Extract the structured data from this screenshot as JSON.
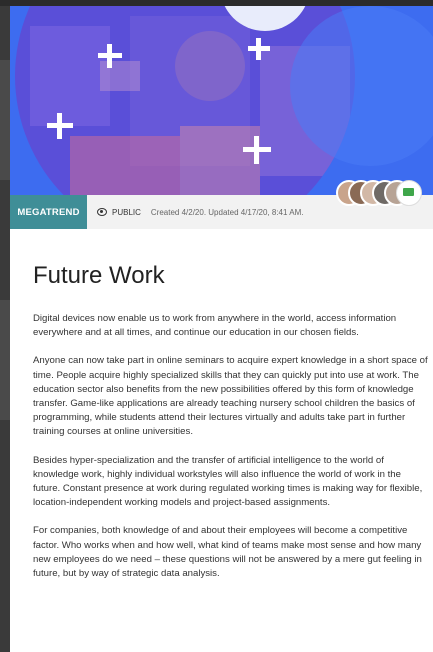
{
  "badge": "MEGATREND",
  "visibility": "PUBLIC",
  "dates": "Created 4/2/20. Updated 4/17/20, 8:41 AM.",
  "title": "Future Work",
  "paragraphs": [
    "Digital devices now enable us to work from anywhere in the world, access information everywhere and at all times, and continue our education in our chosen fields.",
    "Anyone can now take part in online seminars to acquire expert knowledge in a short space of time. People acquire highly specialized skills that they can quickly put into use at work. The education sector also benefits from the new possibilities offered by this form of knowledge transfer. Game-like applications are already teaching nursery school children the basics of programming, while students attend their lectures virtually and adults take part in further training courses at online universities.",
    "Besides hyper-specialization and the transfer of artificial intelligence to the world of knowledge work, highly individual workstyles will also influence the world of work in the future. Constant presence at work during regulated working times is making way for flexible, location-independent working models and project-based assignments.",
    "For companies, both knowledge of and about their employees will become a competitive factor. Who works when and how well, what kind of teams make most sense and how many new employees do we need – these questions will not be answered by a mere gut feeling in future, but by way of strategic data analysis."
  ],
  "colors": {
    "hero_blue": "#3d6cf0",
    "badge_teal": "#3f8e97",
    "chat_green": "#3fa64a"
  },
  "icons": {
    "visibility": "eye-icon",
    "chat": "chat-bubble-icon",
    "hero_decor": "plus-icon"
  }
}
